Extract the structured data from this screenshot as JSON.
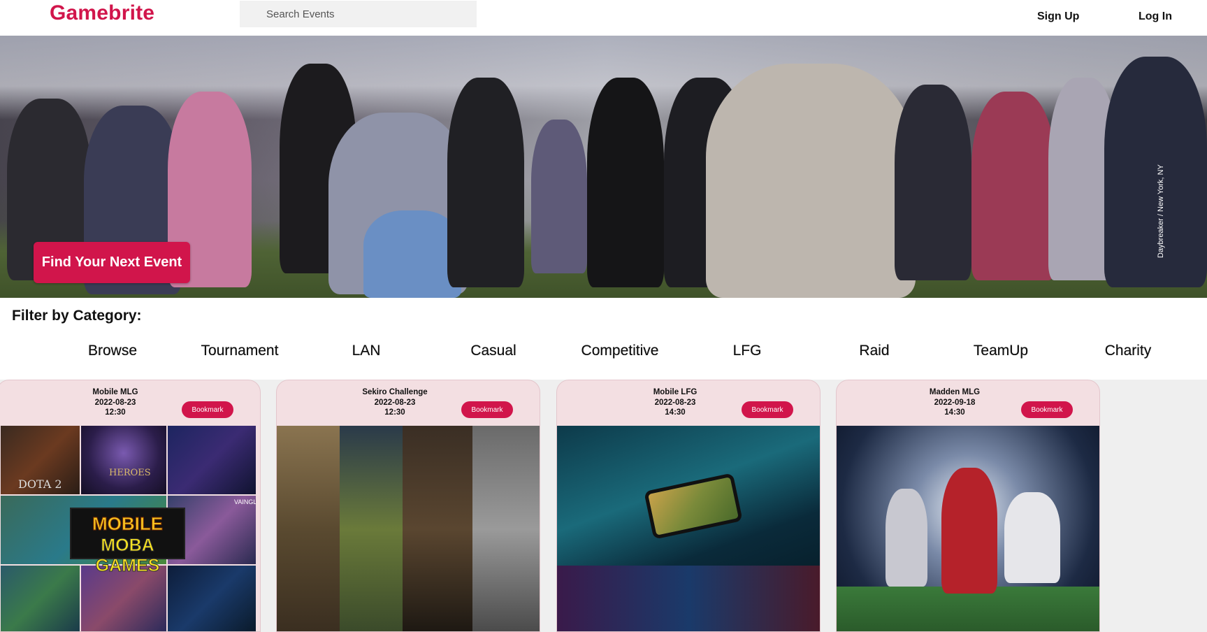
{
  "header": {
    "logo": "Gamebrite",
    "search_placeholder": "Search Events",
    "signup_label": "Sign Up",
    "login_label": "Log In"
  },
  "hero": {
    "cta_label": "Find Your Next Event",
    "photo_credit": "Daybreaker / New York, NY"
  },
  "filter": {
    "title": "Filter by Category:",
    "categories": [
      "Browse",
      "Tournament",
      "LAN",
      "Casual",
      "Competitive",
      "LFG",
      "Raid",
      "TeamUp",
      "Charity"
    ]
  },
  "events": [
    {
      "title": "Mobile MLG",
      "date": "2022-08-23",
      "time": "12:30",
      "bookmark_label": "Bookmark",
      "image_text": {
        "tile1": "DOTA 2",
        "tile2": "HEROES",
        "tile5": "VAINGLORY",
        "banner1": "MOBILE",
        "banner2": "MOBA GAMES"
      }
    },
    {
      "title": "Sekiro Challenge",
      "date": "2022-08-23",
      "time": "12:30",
      "bookmark_label": "Bookmark"
    },
    {
      "title": "Mobile LFG",
      "date": "2022-08-23",
      "time": "14:30",
      "bookmark_label": "Bookmark"
    },
    {
      "title": "Madden MLG",
      "date": "2022-09-18",
      "time": "14:30",
      "bookmark_label": "Bookmark"
    }
  ],
  "colors": {
    "brand": "#d1154b",
    "card_bg": "#f3dfe2"
  }
}
